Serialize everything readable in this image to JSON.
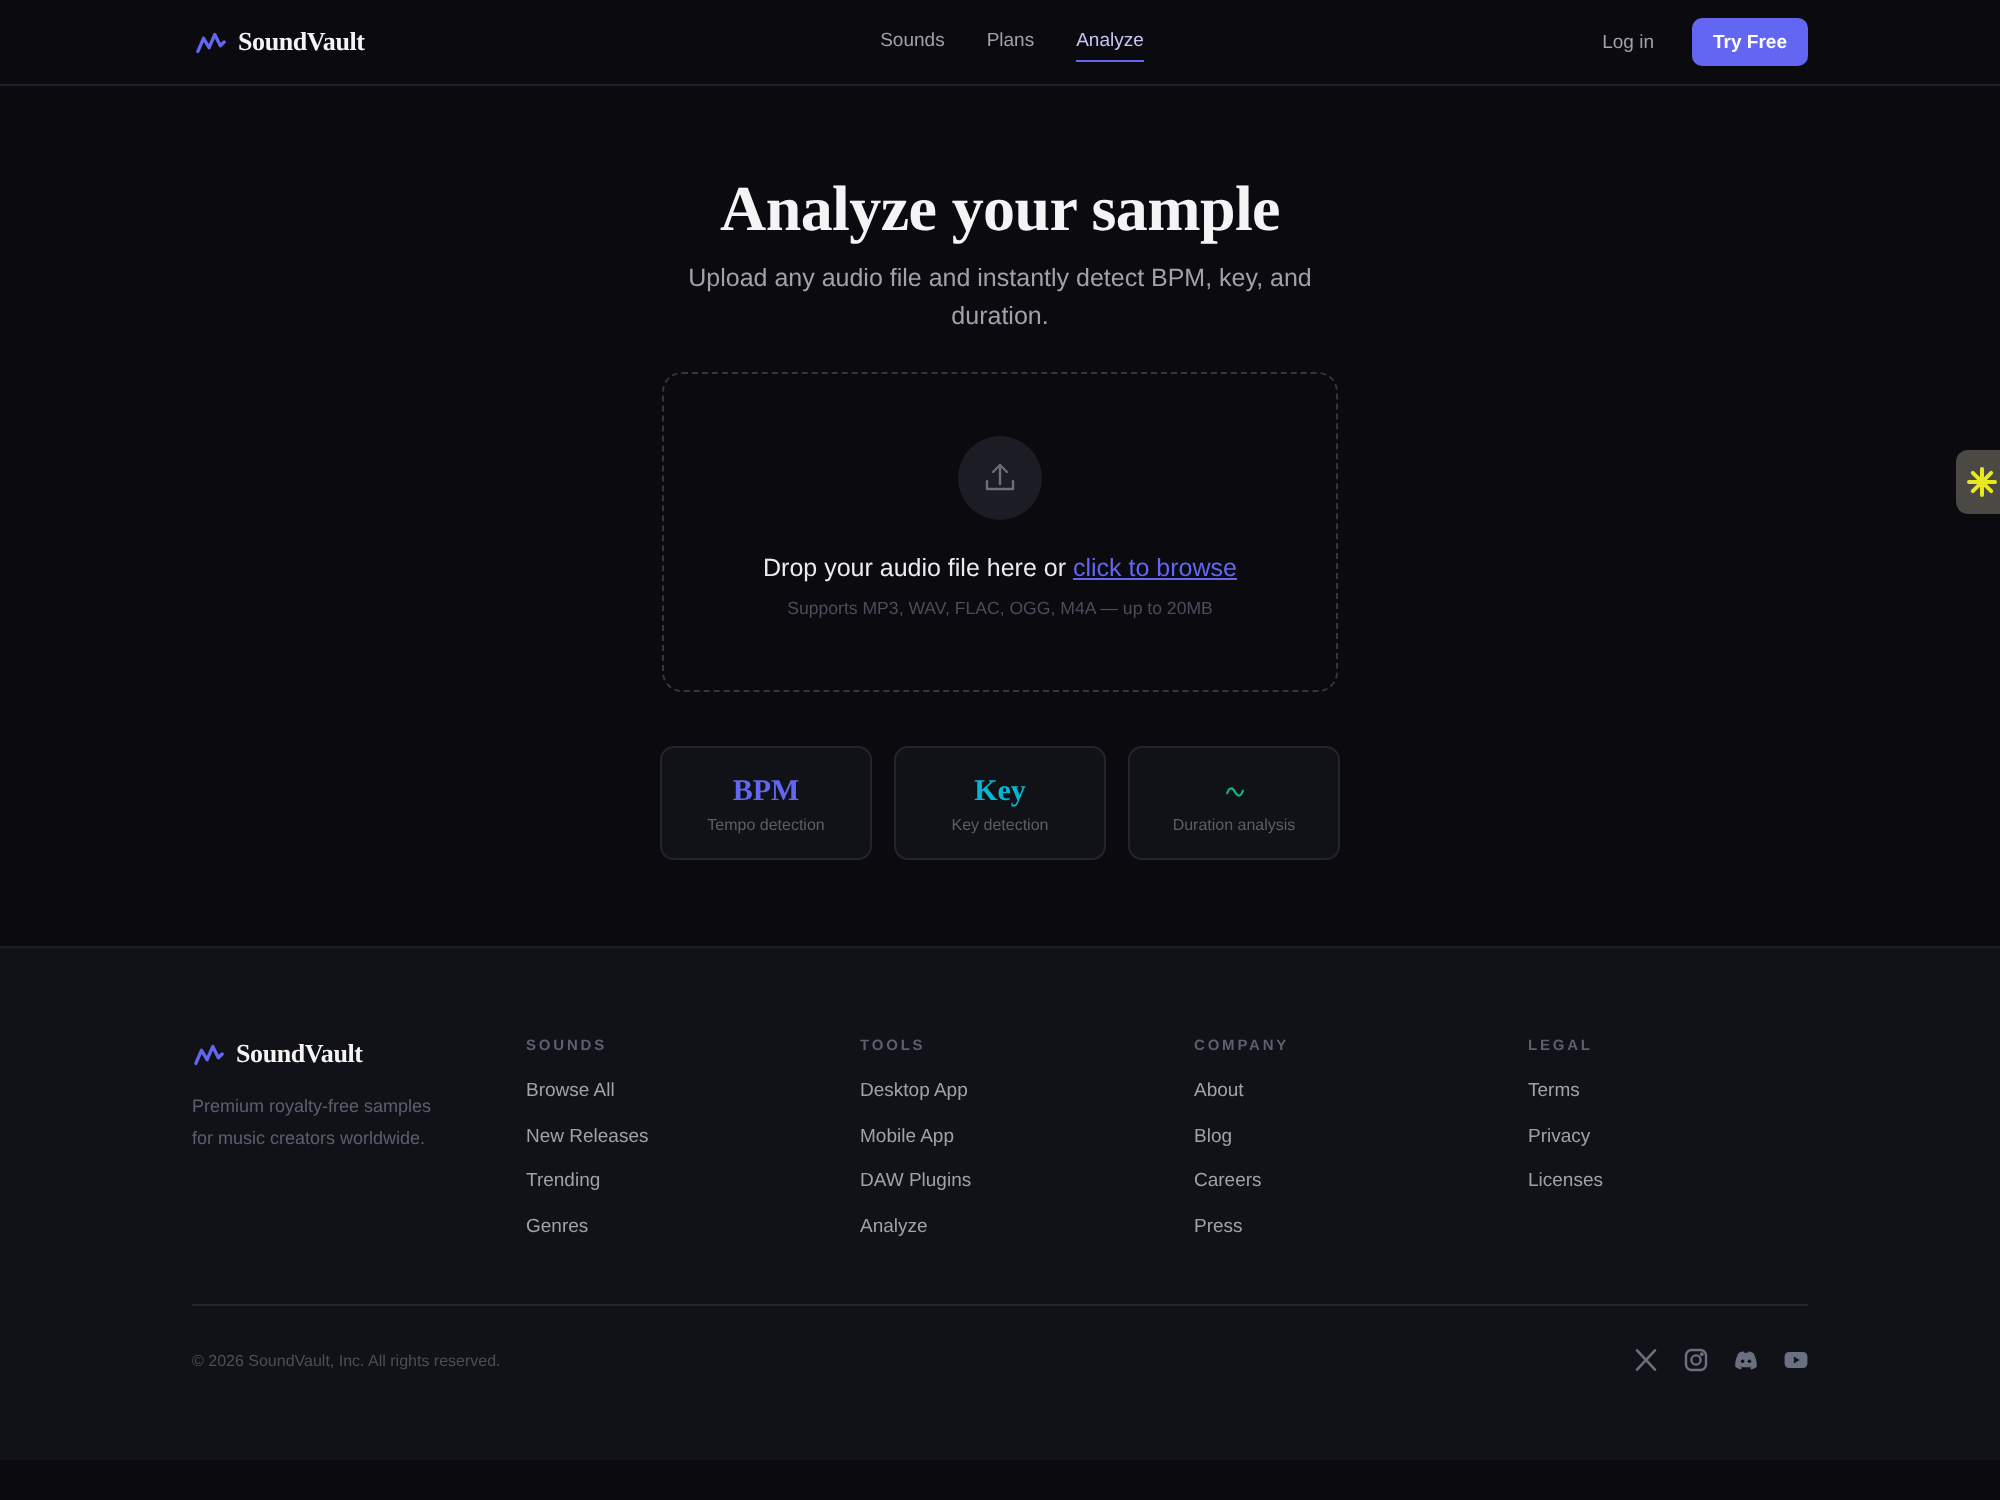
{
  "header": {
    "logo": "SoundVault",
    "nav": [
      {
        "label": "Sounds",
        "selected": false
      },
      {
        "label": "Plans",
        "selected": false
      },
      {
        "label": "Analyze",
        "selected": true
      }
    ],
    "login": "Log in",
    "cta": "Try Free"
  },
  "hero": {
    "title": "Analyze your sample",
    "subtitle": "Upload any audio file and instantly detect BPM, key, and duration."
  },
  "dropzone": {
    "prompt": "Drop your audio file here or",
    "link": "click to browse",
    "hint": "Supports MP3, WAV, FLAC, OGG, M4A — up to 20MB"
  },
  "features": [
    {
      "kind": "text",
      "title": "BPM",
      "color": "#6366f1",
      "caption": "Tempo detection"
    },
    {
      "kind": "text",
      "title": "Key",
      "color": "#06b6d4",
      "caption": "Key detection"
    },
    {
      "kind": "icon",
      "color": "#10b981",
      "caption": "Duration analysis"
    }
  ],
  "footer": {
    "logo": "SoundVault",
    "tagline": "Premium royalty-free samples for music creators worldwide.",
    "columns": [
      {
        "heading": "SOUNDS",
        "links": [
          "Browse All",
          "New Releases",
          "Trending",
          "Genres"
        ]
      },
      {
        "heading": "TOOLS",
        "links": [
          "Desktop App",
          "Mobile App",
          "DAW Plugins",
          "Analyze"
        ]
      },
      {
        "heading": "COMPANY",
        "links": [
          "About",
          "Blog",
          "Careers",
          "Press"
        ]
      },
      {
        "heading": "LEGAL",
        "links": [
          "Terms",
          "Privacy",
          "Licenses"
        ]
      }
    ],
    "copyright": "© 2026 SoundVault, Inc. All rights reserved."
  }
}
